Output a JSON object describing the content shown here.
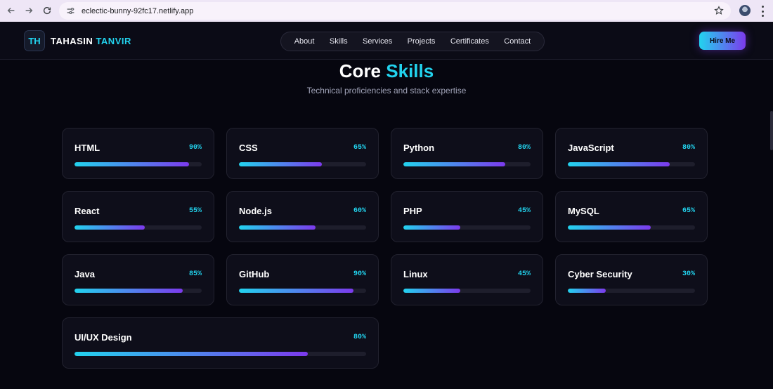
{
  "browser": {
    "url": "eclectic-bunny-92fc17.netlify.app"
  },
  "header": {
    "logo_initials": "TH",
    "brand_first": "TAHASIN",
    "brand_last": "TANVIR",
    "nav": [
      "About",
      "Skills",
      "Services",
      "Projects",
      "Certificates",
      "Contact"
    ],
    "cta": "Hire Me"
  },
  "section": {
    "title_white": "Core",
    "title_accent": "Skills",
    "subtitle": "Technical proficiencies and stack expertise"
  },
  "skills": [
    {
      "name": "HTML",
      "pct_label": "90%",
      "level": 0.9
    },
    {
      "name": "CSS",
      "pct_label": "65%",
      "level": 0.65
    },
    {
      "name": "Python",
      "pct_label": "80%",
      "level": 0.8
    },
    {
      "name": "JavaScript",
      "pct_label": "80%",
      "level": 0.8
    },
    {
      "name": "React",
      "pct_label": "55%",
      "level": 0.55
    },
    {
      "name": "Node.js",
      "pct_label": "60%",
      "level": 0.6
    },
    {
      "name": "PHP",
      "pct_label": "45%",
      "level": 0.45
    },
    {
      "name": "MySQL",
      "pct_label": "65%",
      "level": 0.65
    },
    {
      "name": "Java",
      "pct_label": "85%",
      "level": 0.85
    },
    {
      "name": "GitHub",
      "pct_label": "90%",
      "level": 0.9
    },
    {
      "name": "Linux",
      "pct_label": "45%",
      "level": 0.45
    },
    {
      "name": "Cyber Security",
      "pct_label": "30%",
      "level": 0.3
    },
    {
      "name": "UI/UX Design",
      "pct_label": "80%",
      "level": 0.8
    }
  ],
  "colors": {
    "accent": "#22d3ee",
    "accent2": "#7c3aed",
    "background": "#06060f"
  }
}
